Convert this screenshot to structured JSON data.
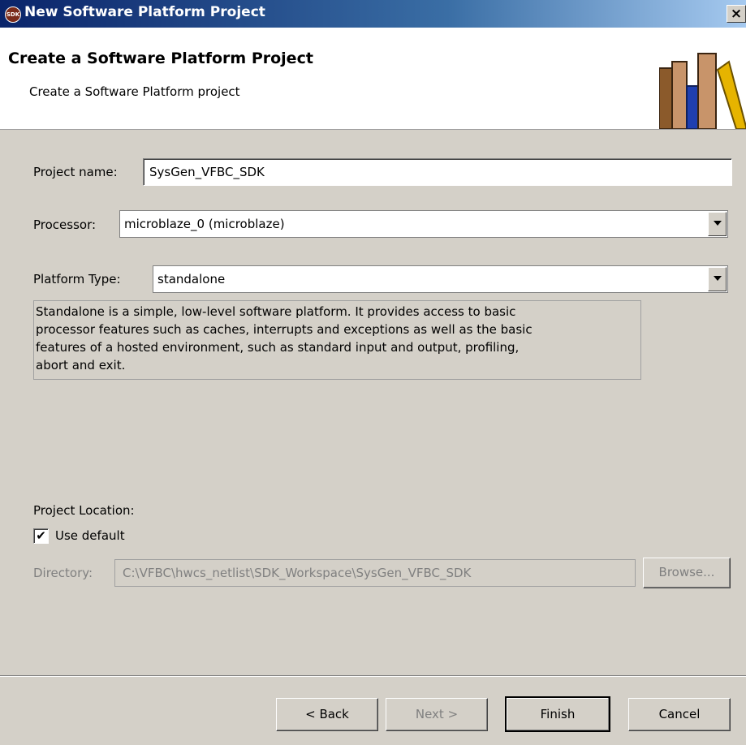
{
  "window": {
    "title": "New Software Platform Project",
    "icon_text": "SDK",
    "close_glyph": "×"
  },
  "banner": {
    "title": "Create a Software Platform Project",
    "subtitle": "Create a Software Platform project"
  },
  "form": {
    "project_name_label": "Project name:",
    "project_name_value": "SysGen_VFBC_SDK",
    "processor_label": "Processor:",
    "processor_value": "microblaze_0 (microblaze)",
    "platform_type_label": "Platform Type:",
    "platform_type_value": "standalone",
    "platform_description": [
      "Standalone is a simple, low-level software platform. It provides access to basic",
      "processor features such as caches, interrupts and exceptions as well as the basic",
      "features of a hosted environment, such as standard input and output, profiling,",
      "abort and exit."
    ],
    "location_label": "Project Location:",
    "use_default_label": "Use default",
    "use_default_checked": true,
    "directory_label": "Directory:",
    "directory_value": "C:\\VFBC\\hwcs_netlist\\SDK_Workspace\\SysGen_VFBC_SDK",
    "browse_label": "Browse..."
  },
  "buttons": {
    "back": "< Back",
    "next": "Next >",
    "finish": "Finish",
    "cancel": "Cancel"
  }
}
